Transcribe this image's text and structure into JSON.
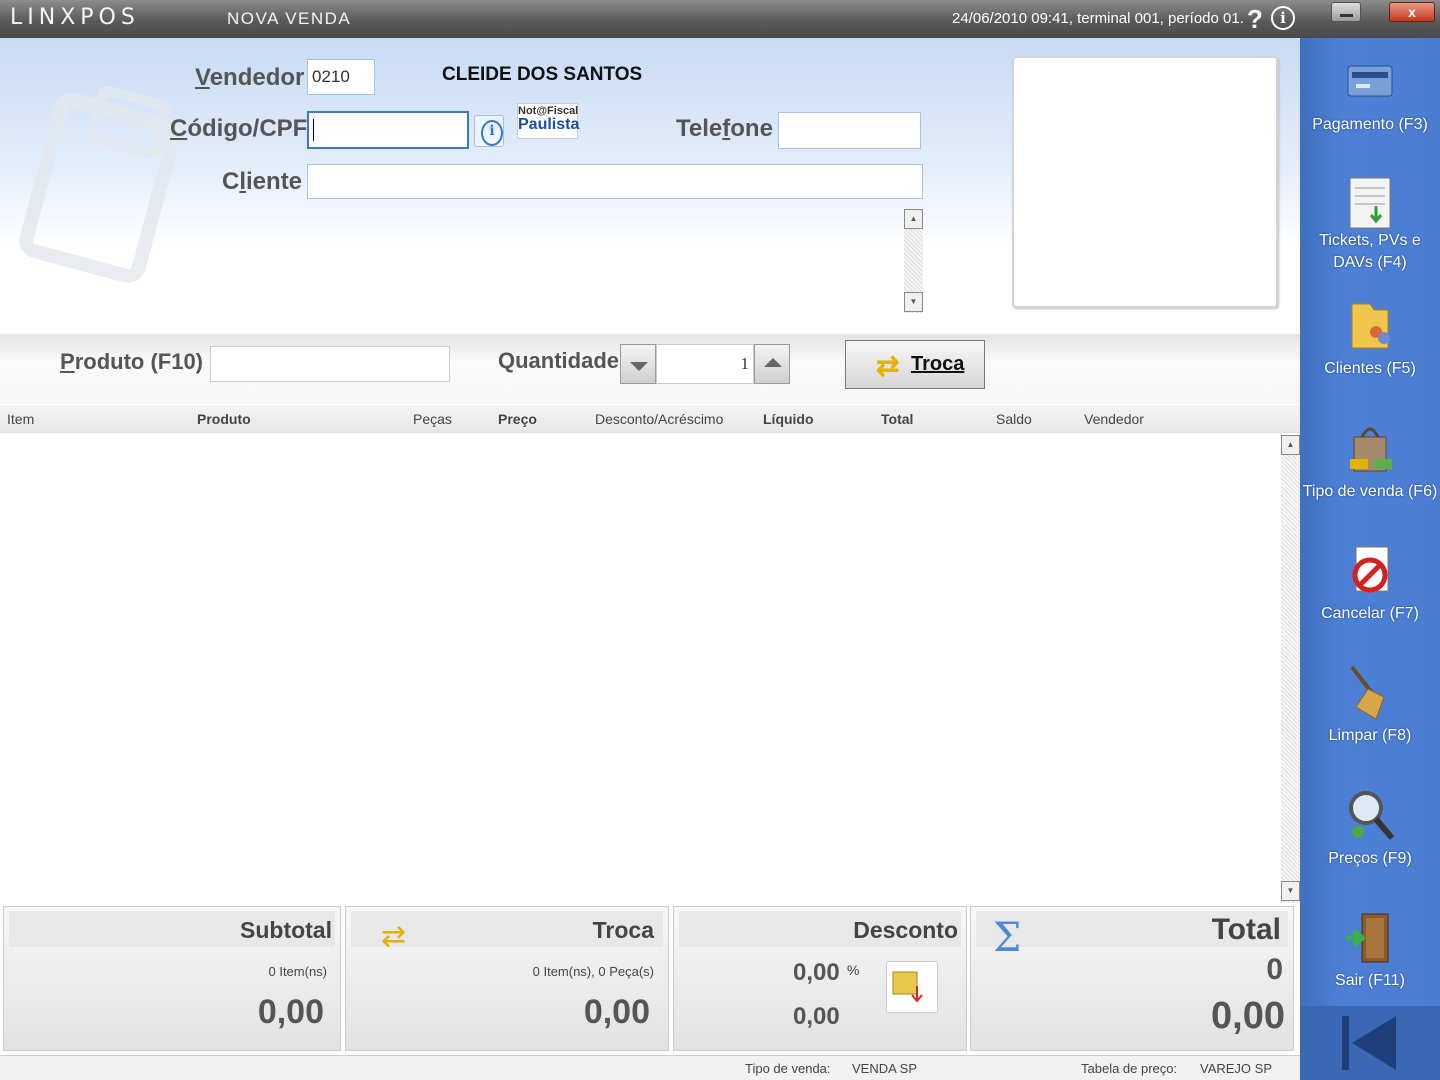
{
  "titlebar": {
    "logo": "LINXPOS",
    "title": "Nova venda",
    "status": "24/06/2010 09:41, terminal 001, período 01.",
    "help": "?",
    "info": "i",
    "close": "x"
  },
  "form": {
    "vendedor_label": "Vendedor",
    "vendedor_value": "0210",
    "vendedor_name": "CLEIDE DOS SANTOS",
    "codigo_label": "Código/CPF",
    "codigo_value": "",
    "nfp_top": "Not@Fiscal",
    "nfp_bottom": "Paulista",
    "telefone_label": "Telefone",
    "telefone_value": "",
    "cliente_label": "Cliente",
    "cliente_value": ""
  },
  "product": {
    "produto_label": "Produto (F10)",
    "produto_value": "",
    "quantidade_label": "Quantidade",
    "quantidade_value": "1",
    "troca_button": "Troca"
  },
  "grid": {
    "columns": [
      "Item",
      "Produto",
      "Peças",
      "Preço",
      "Desconto/Acréscimo",
      "Líquido",
      "Total",
      "Saldo",
      "Vendedor"
    ],
    "rows": []
  },
  "totals": {
    "subtotal": {
      "title": "Subtotal",
      "items": "0 Item(ns)",
      "value": "0,00"
    },
    "troca": {
      "title": "Troca",
      "items": "0 Item(ns), 0 Peça(s)",
      "value": "0,00"
    },
    "desconto": {
      "title": "Desconto",
      "percent": "0,00",
      "percent_sign": "%",
      "value": "0,00"
    },
    "total": {
      "title": "Total",
      "count": "0",
      "value": "0,00"
    }
  },
  "statusbar": {
    "tipo_label": "Tipo de venda:",
    "tipo_value": "VENDA SP",
    "tabela_label": "Tabela de preço:",
    "tabela_value": "VAREJO SP"
  },
  "sidebar": {
    "items": [
      {
        "label": "Pagamento (F3)",
        "icon": "payment-icon"
      },
      {
        "label": "Tickets, PVs e DAVs (F4)",
        "icon": "tickets-icon"
      },
      {
        "label": "Clientes (F5)",
        "icon": "clients-folder-icon"
      },
      {
        "label": "Tipo de venda (F6)",
        "icon": "shopping-bag-icon"
      },
      {
        "label": "Cancelar (F7)",
        "icon": "cancel-icon"
      },
      {
        "label": "Limpar (F8)",
        "icon": "broom-icon"
      },
      {
        "label": "Preços (F9)",
        "icon": "magnifier-icon"
      },
      {
        "label": "Sair (F11)",
        "icon": "exit-door-icon"
      }
    ]
  },
  "colors": {
    "sidebar_blue": "#4a7cd0",
    "top_gradient": "#c7dbf4",
    "accent_yellow": "#e2b200"
  }
}
